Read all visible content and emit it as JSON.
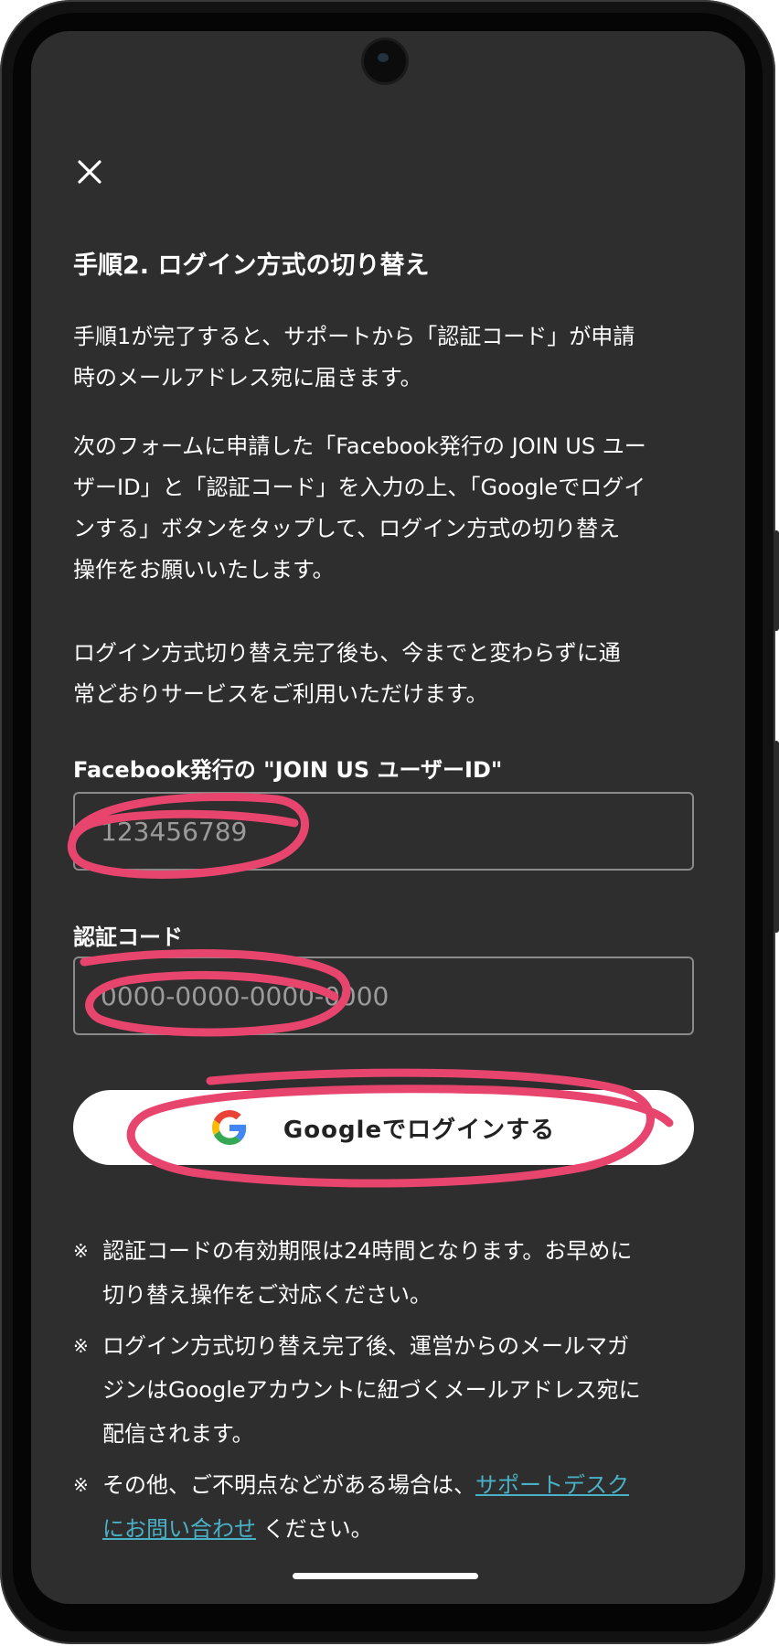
{
  "header": {
    "close_icon": "close-icon"
  },
  "content": {
    "title": "手順2. ログイン方式の切り替え",
    "para1_lines": [
      "手順1が完了すると、サポートから「認証コード」が申請",
      "時のメールアドレス宛に届きます。"
    ],
    "para2_lines": [
      "次のフォームに申請した「Facebook発行の JOIN US ユー",
      "ザーID」と「認証コード」を入力の上、「Googleでログイ",
      "ンする」ボタンをタップして、ログイン方式の切り替え",
      "操作をお願いいたします。"
    ],
    "para3_lines": [
      "ログイン方式切り替え完了後も、今までと変わらずに通",
      "常どおりサービスをご利用いただけます。"
    ]
  },
  "form": {
    "user_id_label": "Facebook発行の \"JOIN US ユーザーID\"",
    "user_id_placeholder": "123456789",
    "code_label": "認証コード",
    "code_placeholder": "0000-0000-0000-0000",
    "google_button_label": "Googleでログインする",
    "google_icon": "google-g-logo"
  },
  "notes": {
    "mark": "※",
    "note1_lines": [
      "認証コードの有効期限は24時間となります。お早めに",
      "切り替え操作をご対応ください。"
    ],
    "note2_lines": [
      "ログイン方式切り替え完了後、運営からのメールマガ",
      "ジンはGoogleアカウントに紐づくメールアドレス宛に",
      "配信されます。"
    ],
    "note3_prefix": "その他、ご不明点などがある場合は、",
    "note3_link_line1": "サポートデスク",
    "note3_link_line2": "にお問い合わせ",
    "note3_suffix": " ください。"
  },
  "colors": {
    "background": "#2e2e2e",
    "text": "#ffffff",
    "link": "#4ab0c6",
    "highlight_scribble": "#e8456e",
    "button_bg": "#ffffff"
  }
}
